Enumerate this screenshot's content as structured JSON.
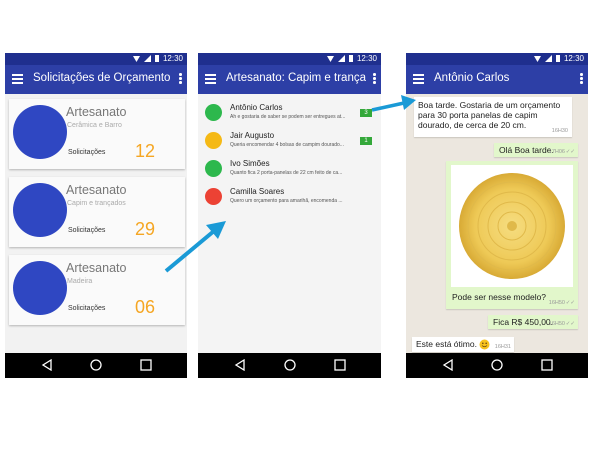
{
  "status": {
    "time": "12:30"
  },
  "screen1": {
    "title": "Solicitações de Orçamento",
    "cards": [
      {
        "title": "Artesanato",
        "subtitle": "Cerâmica e Barro",
        "label": "Solicitações",
        "count": "12"
      },
      {
        "title": "Artesanato",
        "subtitle": "Capim e trançados",
        "label": "Solicitações",
        "count": "29"
      },
      {
        "title": "Artesanato",
        "subtitle": "Madeira",
        "label": "Solicitações",
        "count": "06"
      }
    ]
  },
  "screen2": {
    "title": "Artesanato: Capim e trança...",
    "contacts": [
      {
        "name": "Antônio Carlos",
        "message": "Ah e gostaria de saber se podem ser entregues at...",
        "badge": "3",
        "color": "#2db84d"
      },
      {
        "name": "Jair Augusto",
        "message": "Queria encomendar 4  bolsas de campim dourado...",
        "badge": "1",
        "color": "#f5b915"
      },
      {
        "name": "Ivo Simões",
        "message": "Quanto fica 2 porta-panelas de 22 cm feito de ca...",
        "badge": "",
        "color": "#2db84d"
      },
      {
        "name": "Camilla Soares",
        "message": "Quero um orçamento para amarihã, encomenda ...",
        "badge": "",
        "color": "#ec4234"
      }
    ]
  },
  "screen3": {
    "title": "Antônio Carlos",
    "messages": [
      {
        "text": "Boa tarde. Gostaria de um orçamento para 30 porta panelas de capim dourado, de cerca de 20 cm.",
        "time": "16H30"
      },
      {
        "text": "Olá Boa tarde.",
        "time": "17H06"
      },
      {
        "text": "Pode ser nesse modelo?",
        "time": "16H50"
      },
      {
        "text": "Fica R$ 450,00.",
        "time": "16H50"
      },
      {
        "text": "Este está ótimo.",
        "time": "16H31"
      }
    ]
  },
  "colors": {
    "appbar": "#2d3fa6",
    "statusbar": "#1f2f8e",
    "accent_count": "#f5a623",
    "arrow": "#1a9ad6",
    "outgoing_bubble": "#e2f7cb"
  }
}
